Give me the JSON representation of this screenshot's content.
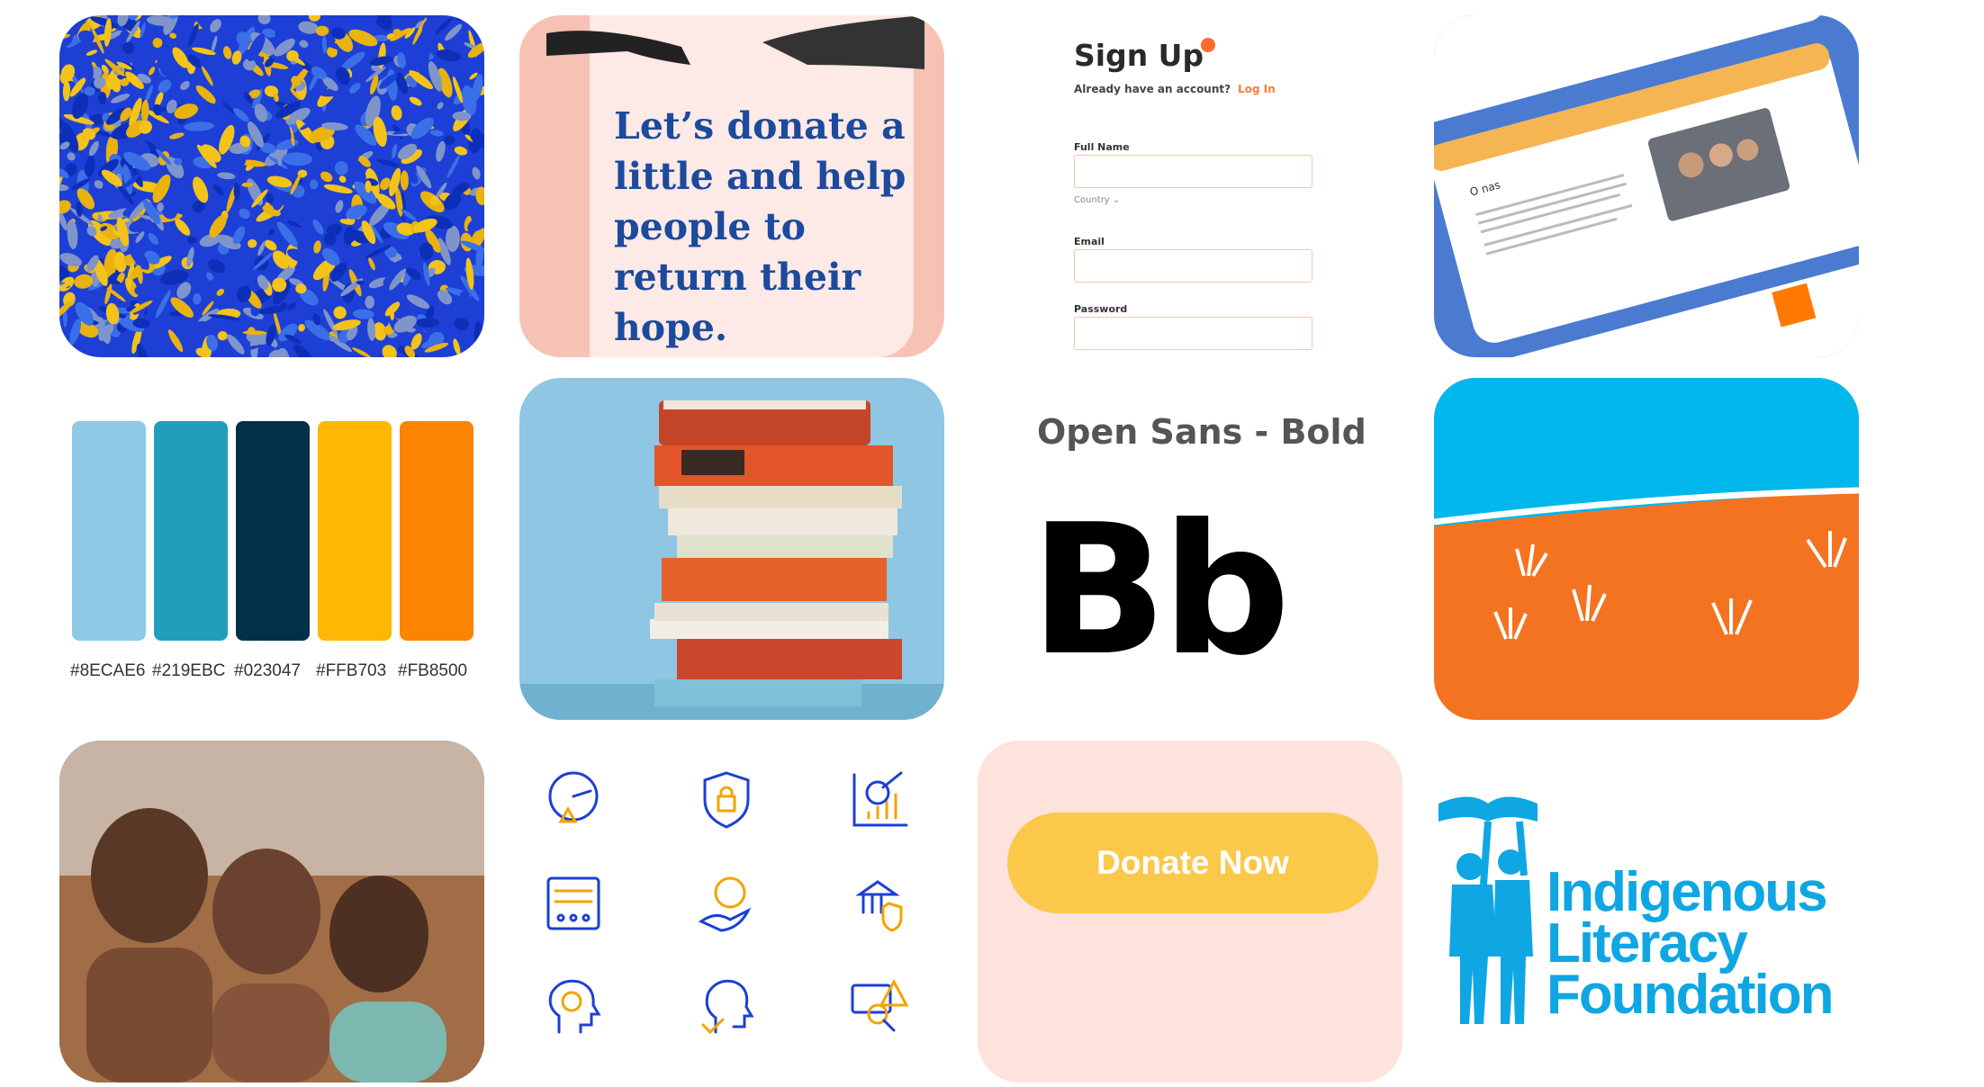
{
  "donate_card": {
    "text": "Let’s donate a little and help people to return their hope."
  },
  "signup": {
    "title": "Sign Up",
    "subtitle": "Already have an account?",
    "login_link": "Log In",
    "full_name_label": "Full Name",
    "country_label": "Country",
    "email_label": "Email",
    "password_label": "Password",
    "accent_color": "#ff6a2e"
  },
  "website_mockup": {
    "heading": "O nas",
    "accent_color": "#4a7bd0",
    "bar_color": "#f5b552"
  },
  "palette": {
    "swatches": [
      {
        "hex": "#8ECAE6",
        "color": "#8ECAE6"
      },
      {
        "hex": "#219EBC",
        "color": "#219EBC"
      },
      {
        "hex": "#023047",
        "color": "#023047"
      },
      {
        "hex": "#FFB703",
        "color": "#FFB703"
      },
      {
        "hex": "#FB8500",
        "color": "#FB8500"
      }
    ]
  },
  "typography": {
    "font_name": "Open Sans - Bold",
    "sample": "Bb"
  },
  "icons": [
    "speedometer-warning-icon",
    "shield-lock-icon",
    "chart-check-icon",
    "control-panel-icon",
    "hand-dollar-icon",
    "bank-shield-icon",
    "head-brain-icon",
    "head-check-icon",
    "monitor-search-warning-icon"
  ],
  "cta": {
    "button_label": "Donate Now"
  },
  "logo": {
    "line1": "Indigenous",
    "line2": "Literacy",
    "line3": "Foundation",
    "color": "#0fa6e4"
  }
}
